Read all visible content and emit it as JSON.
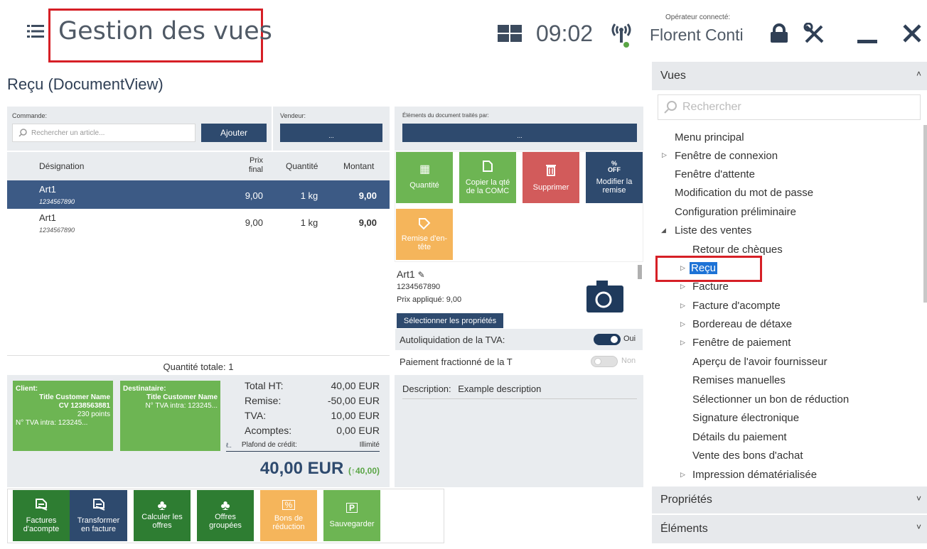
{
  "header": {
    "app_title": "Gestion des vues",
    "time": "09:02",
    "operator_label": "Opérateur connecté:",
    "operator_name": "Florent Conti"
  },
  "document": {
    "title": "Reçu (DocumentView)"
  },
  "order": {
    "command_label": "Commande:",
    "search_placeholder": "Rechercher un article...",
    "add_button": "Ajouter",
    "seller_label": "Vendeur:",
    "seller_value": "...",
    "processed_label": "Éléments du document traités par:",
    "processed_value": "..."
  },
  "table": {
    "headers": {
      "designation": "Désignation",
      "price_line1": "Prix",
      "price_line2": "final",
      "quantity": "Quantité",
      "amount": "Montant"
    },
    "rows": [
      {
        "name": "Art1",
        "code": "1234567890",
        "price": "9,00",
        "qty": "1 kg",
        "amount": "9,00"
      },
      {
        "name": "Art1",
        "code": "1234567890",
        "price": "9,00",
        "qty": "1 kg",
        "amount": "9,00"
      }
    ],
    "total_quantity": "Quantité totale: 1"
  },
  "actions": {
    "quantity": "Quantité",
    "copy_line1": "Copier la qté",
    "copy_line2": "de la COMC",
    "delete": "Supprimer",
    "discount_line1": "Modifier la",
    "discount_line2": "remise",
    "discount_icon": "%",
    "discount_icon2": "OFF",
    "header_discount_line1": "Remise d'en-",
    "header_discount_line2": "tête"
  },
  "item_detail": {
    "name": "Art1",
    "code": "1234567890",
    "applied_price": "Prix appliqué: 9,00",
    "select_props": "Sélectionner les propriétés",
    "auto_vat_label": "Autoliquidation de la TVA:",
    "auto_vat_value": "Oui",
    "split_payment_label": "Paiement fractionné de la T",
    "split_payment_value": "Non",
    "description_label": "Description:",
    "description_value": "Example description"
  },
  "customer": {
    "client_label": "Client:",
    "client_name": "Title Customer Name",
    "client_cv": "CV 1238563881",
    "client_points": "230 points",
    "client_vat": "N° TVA intra: 123245...",
    "recipient_label": "Destinataire:",
    "recipient_name": "Title Customer Name",
    "recipient_vat": "N° TVA intra: 123245..."
  },
  "totals": {
    "ht_label": "Total HT:",
    "ht_value": "40,00 EUR",
    "discount_label": "Remise:",
    "discount_value": "-50,00 EUR",
    "vat_label": "TVA:",
    "vat_value": "10,00 EUR",
    "deposit_label": "Acomptes:",
    "deposit_value": "0,00 EUR",
    "credit_label": "Plafond de crédit:",
    "credit_value": "Illimité",
    "grand_total": "40,00 EUR",
    "grand_total_sub": "(↑40,00)"
  },
  "bottom_buttons": [
    {
      "line1": "Factures",
      "line2": "d'acompte"
    },
    {
      "line1": "Transformer",
      "line2": "en facture"
    },
    {
      "line1": "Calculer les",
      "line2": "offres"
    },
    {
      "line1": "Offres",
      "line2": "groupées"
    },
    {
      "line1": "Bons de",
      "line2": "réduction"
    },
    {
      "line1": "Sauvegarder",
      "line2": ""
    }
  ],
  "sidebar": {
    "views_header": "Vues",
    "search_placeholder": "Rechercher",
    "items": [
      "Menu principal",
      "Fenêtre de connexion",
      "Fenêtre d'attente",
      "Modification du mot de passe",
      "Configuration préliminaire",
      "Liste des ventes",
      "Retour de chèques",
      "Reçu",
      "Facture",
      "Facture d'acompte",
      "Bordereau de détaxe",
      "Fenêtre de paiement",
      "Aperçu de l'avoir fournisseur",
      "Remises manuelles",
      "Sélectionner un bon de réduction",
      "Signature électronique",
      "Détails du paiement",
      "Vente des bons d'achat",
      "Impression dématérialisée"
    ],
    "properties_header": "Propriétés",
    "elements_header": "Éléments"
  },
  "colors": {
    "navy": "#2e4a6e",
    "green": "#5aa545",
    "dark_green": "#2e7d32",
    "red": "#d25b5b",
    "orange": "#f0ad4e",
    "highlight": "#d61f26",
    "selection": "#1e73d6"
  }
}
